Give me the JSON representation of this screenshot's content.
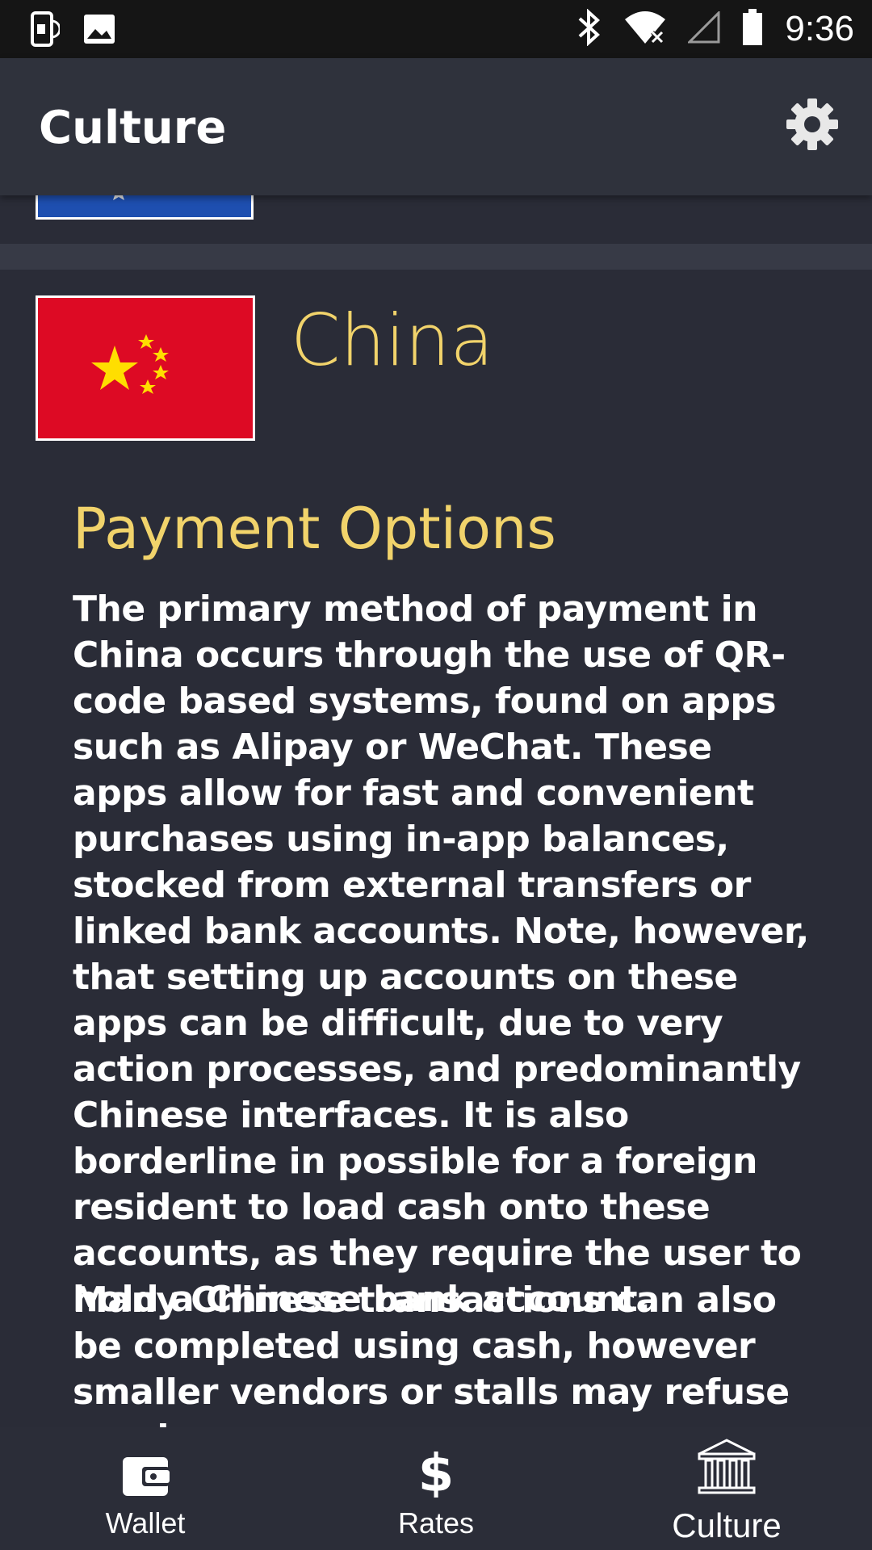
{
  "status_bar": {
    "time": "9:36",
    "icons": [
      "screen-rotation-icon",
      "image-icon",
      "bluetooth-icon",
      "wifi-off-icon",
      "cellular-icon",
      "battery-icon"
    ]
  },
  "app_bar": {
    "title": "Culture",
    "settings_icon": "gear-icon"
  },
  "country": {
    "name": "China",
    "flag": "china-flag"
  },
  "section": {
    "title": "Payment Options",
    "paragraph_1": "The primary method of payment in China occurs through the use of QR-code based systems, found on apps such as Alipay or WeChat. These apps allow for fast and convenient purchases using in-app balances, stocked from external transfers or linked bank accounts. Note, however, that setting up accounts on these apps can be difficult, due to very action processes, and predominantly Chinese interfaces. It is also borderline in possible for a foreign resident to load cash onto these accounts, as they require the user to hold a Chinese bank account.",
    "paragraph_2": "Many Chinese transactions can also be completed using cash, however smaller vendors or stalls may refuse service"
  },
  "bottom_nav": {
    "items": [
      {
        "label": "Wallet",
        "icon": "wallet-icon"
      },
      {
        "label": "Rates",
        "icon": "dollar-icon"
      },
      {
        "label": "Culture",
        "icon": "museum-icon",
        "active": true
      }
    ]
  },
  "colors": {
    "background": "#2a2c37",
    "app_bar": "#2f323c",
    "accent_yellow": "#f1d36b",
    "china_red": "#dd0a24",
    "china_star": "#ffde00"
  }
}
